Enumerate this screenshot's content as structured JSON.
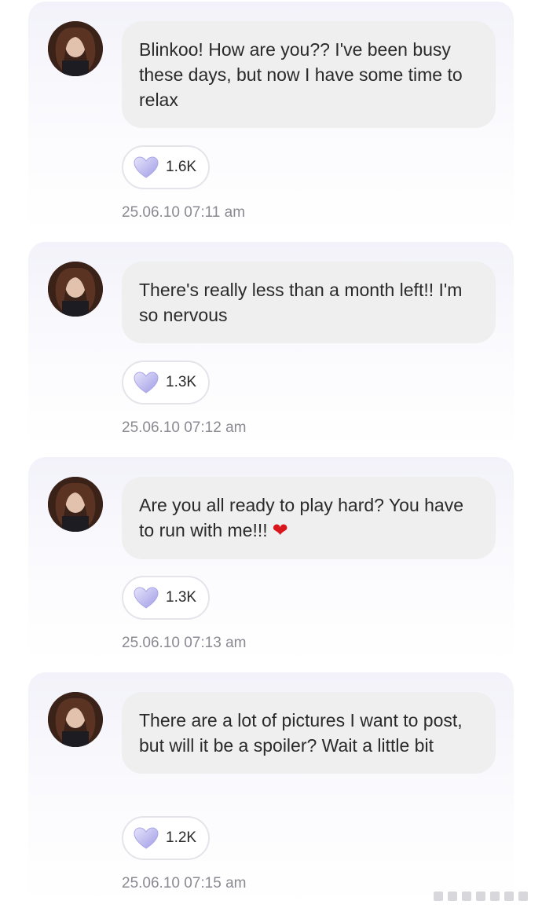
{
  "messages": [
    {
      "text": "Blinkoo! How are you?? I've been busy these days, but now I have some time to relax",
      "likes": "1.6K",
      "timestamp": "25.06.10 07:11 am",
      "emoji": ""
    },
    {
      "text": "There's really less than a month left!! I'm so nervous",
      "likes": "1.3K",
      "timestamp": "25.06.10 07:12 am",
      "emoji": ""
    },
    {
      "text": "Are you all ready to play hard? You have to run with me!!!",
      "likes": "1.3K",
      "timestamp": "25.06.10 07:13 am",
      "emoji": "❤"
    },
    {
      "text": "There are a lot of pictures I want to post, but will it be a spoiler? Wait a little bit",
      "likes": "1.2K",
      "timestamp": "25.06.10 07:15 am",
      "emoji": ""
    }
  ],
  "icons": {
    "avatar": "profile-avatar",
    "like": "lavender-heart-icon",
    "emoji": "red-heart-emoji"
  },
  "colors": {
    "bubble_bg": "#efefef",
    "card_bg": "#f3f2fa",
    "heart_lavender": "#b9b6ef",
    "emoji_red": "#d9161c",
    "timestamp": "#8a8a93"
  }
}
